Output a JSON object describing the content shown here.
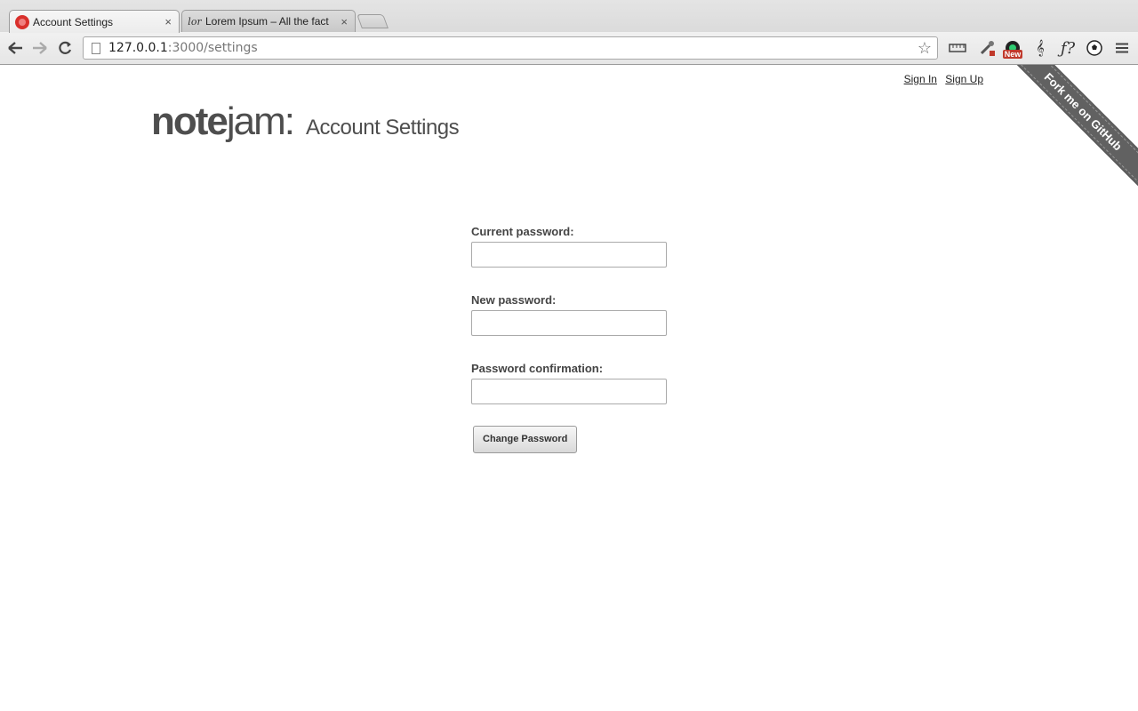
{
  "browser": {
    "tabs": [
      {
        "title": "Account Settings",
        "close": "×",
        "active": true
      },
      {
        "title": "Lorem Ipsum – All the fact",
        "favicon_text": "lor",
        "close": "×",
        "active": false
      }
    ],
    "url_host": "127.0.0.1",
    "url_rest": ":3000/settings",
    "extension_badge": "New"
  },
  "header": {
    "logo_bold": "note",
    "logo_light": "jam",
    "logo_colon": ":",
    "page_title": "Account Settings",
    "sign_in": "Sign In",
    "sign_up": "Sign Up",
    "ribbon": "Fork me on GitHub"
  },
  "form": {
    "current_password_label": "Current password:",
    "current_password_value": "",
    "new_password_label": "New password:",
    "new_password_value": "",
    "confirmation_label": "Password confirmation:",
    "confirmation_value": "",
    "submit_label": "Change Password"
  }
}
